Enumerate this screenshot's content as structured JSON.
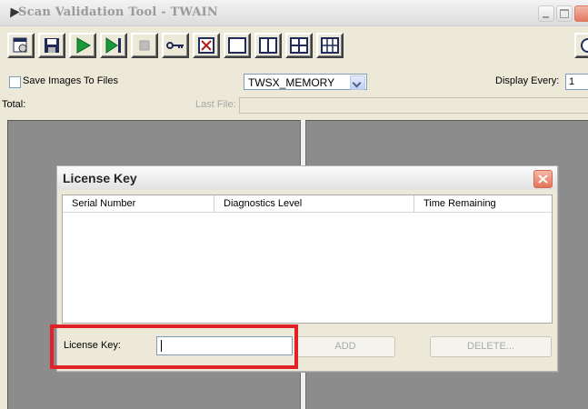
{
  "window": {
    "title": "Scan Validation Tool - TWAIN"
  },
  "toolbar": {
    "buttons": [
      {
        "name": "properties-icon"
      },
      {
        "name": "save-icon"
      },
      {
        "name": "play-icon"
      },
      {
        "name": "step-icon"
      },
      {
        "name": "stop-icon"
      },
      {
        "name": "key-icon"
      },
      {
        "name": "close-image-icon"
      },
      {
        "name": "layout-single-icon"
      },
      {
        "name": "layout-two-icon"
      },
      {
        "name": "layout-four-icon"
      },
      {
        "name": "layout-six-icon"
      }
    ]
  },
  "options": {
    "save_images_label": "Save Images To Files",
    "save_images_checked": false,
    "transfer_mode": "TWSX_MEMORY",
    "display_every_label": "Display Every:",
    "display_every_value": "1"
  },
  "status": {
    "total_label": "Total:",
    "last_file_label": "Last File:",
    "last_file_value": ""
  },
  "dialog": {
    "title": "License Key",
    "columns": [
      "Serial Number",
      "Diagnostics Level",
      "Time Remaining"
    ],
    "license_key_label": "License Key:",
    "license_key_value": "",
    "add_label": "ADD",
    "delete_label": "DELETE..."
  },
  "colors": {
    "highlight": "#e22027",
    "pane": "#8c8c8c"
  }
}
